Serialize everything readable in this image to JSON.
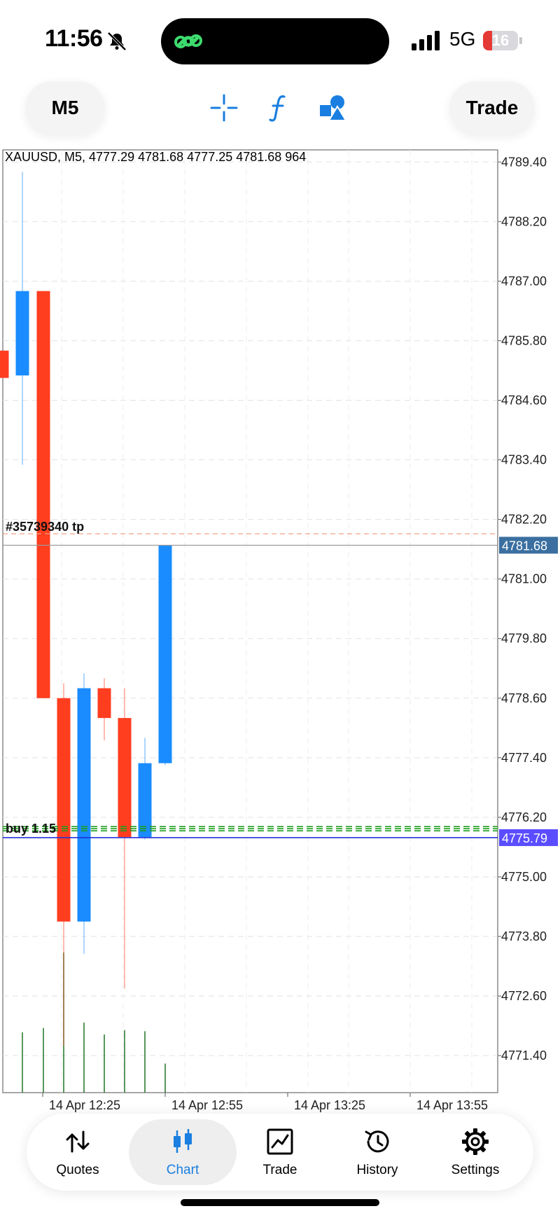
{
  "status_bar": {
    "time": "11:56",
    "network": "5G",
    "battery": "16"
  },
  "toolbar": {
    "timeframe": "M5",
    "trade_label": "Trade"
  },
  "chart_data": {
    "type": "candlestick",
    "title": "XAUUSD, M5, 4777.29 4781.68 4777.25 4781.68 964",
    "symbol": "XAUUSD",
    "timeframe": "M5",
    "y_ticks": [
      "4789.40",
      "4788.20",
      "4787.00",
      "4785.80",
      "4784.60",
      "4783.40",
      "4782.20",
      "4781.00",
      "4779.80",
      "4778.60",
      "4777.40",
      "4776.20",
      "4775.00",
      "4773.80",
      "4772.60",
      "4771.40"
    ],
    "ylim": [
      4770.4,
      4789.7
    ],
    "x_ticks": [
      "14 Apr 12:25",
      "14 Apr 12:55",
      "14 Apr 13:25",
      "14 Apr 13:55"
    ],
    "candles": [
      {
        "open": 4785.6,
        "high": 4785.6,
        "low": 4785.05,
        "close": 4785.05,
        "volume": 0
      },
      {
        "open": 4785.1,
        "high": 4789.2,
        "low": 4783.3,
        "close": 4786.8,
        "volume": 560
      },
      {
        "open": 4786.8,
        "high": 4786.8,
        "low": 4778.6,
        "close": 4778.6,
        "volume": 600
      },
      {
        "open": 4778.6,
        "high": 4778.9,
        "low": 4771.6,
        "close": 4774.1,
        "volume": 1300
      },
      {
        "open": 4774.1,
        "high": 4779.1,
        "low": 4773.45,
        "close": 4778.8,
        "volume": 650
      },
      {
        "open": 4778.8,
        "high": 4779.0,
        "low": 4777.75,
        "close": 4778.2,
        "volume": 540
      },
      {
        "open": 4778.2,
        "high": 4778.8,
        "low": 4772.75,
        "close": 4775.8,
        "volume": 580
      },
      {
        "open": 4775.8,
        "high": 4777.8,
        "low": 4775.75,
        "close": 4777.29,
        "volume": 570
      },
      {
        "open": 4777.29,
        "high": 4781.68,
        "low": 4777.25,
        "close": 4781.68,
        "volume": 270
      }
    ],
    "current_price": "4781.68",
    "bid_line": "4775.79",
    "tp_level": 4781.91,
    "tp_label": "#35739340 tp",
    "position_label": "buy 1.15",
    "position_level": 4775.97,
    "colors": {
      "bull": "#1a8cff",
      "bear": "#ff3d1f",
      "volume": "#2e7d32",
      "price_badge": "#3a6fa0",
      "bid_badge": "#5b4dff",
      "position": "#1b9e1b"
    }
  },
  "nav": {
    "items": [
      {
        "label": "Quotes",
        "icon": "quotes-icon"
      },
      {
        "label": "Chart",
        "icon": "chart-icon"
      },
      {
        "label": "Trade",
        "icon": "trade-icon"
      },
      {
        "label": "History",
        "icon": "history-icon"
      },
      {
        "label": "Settings",
        "icon": "settings-icon"
      }
    ],
    "active": "Chart",
    "accent": "#1a7fe0"
  }
}
